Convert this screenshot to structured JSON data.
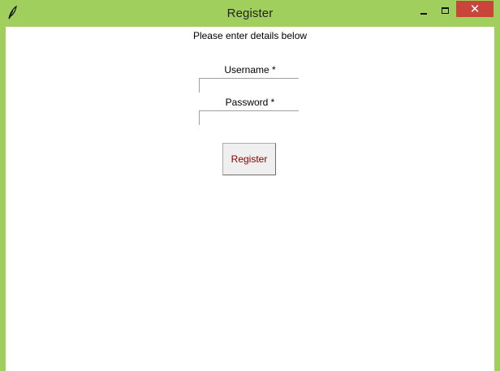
{
  "window": {
    "title": "Register",
    "icon": "feather-icon",
    "controls": {
      "minimize": "minimize-icon",
      "maximize": "maximize-icon",
      "close": "✕"
    },
    "frame_color": "#a1cf5d",
    "close_color": "#c7453b"
  },
  "form": {
    "instructions": "Please enter details below",
    "username_label": "Username *",
    "username_value": "",
    "password_label": "Password *",
    "password_value": "",
    "register_label": "Register",
    "register_text_color": "#8b0000"
  }
}
